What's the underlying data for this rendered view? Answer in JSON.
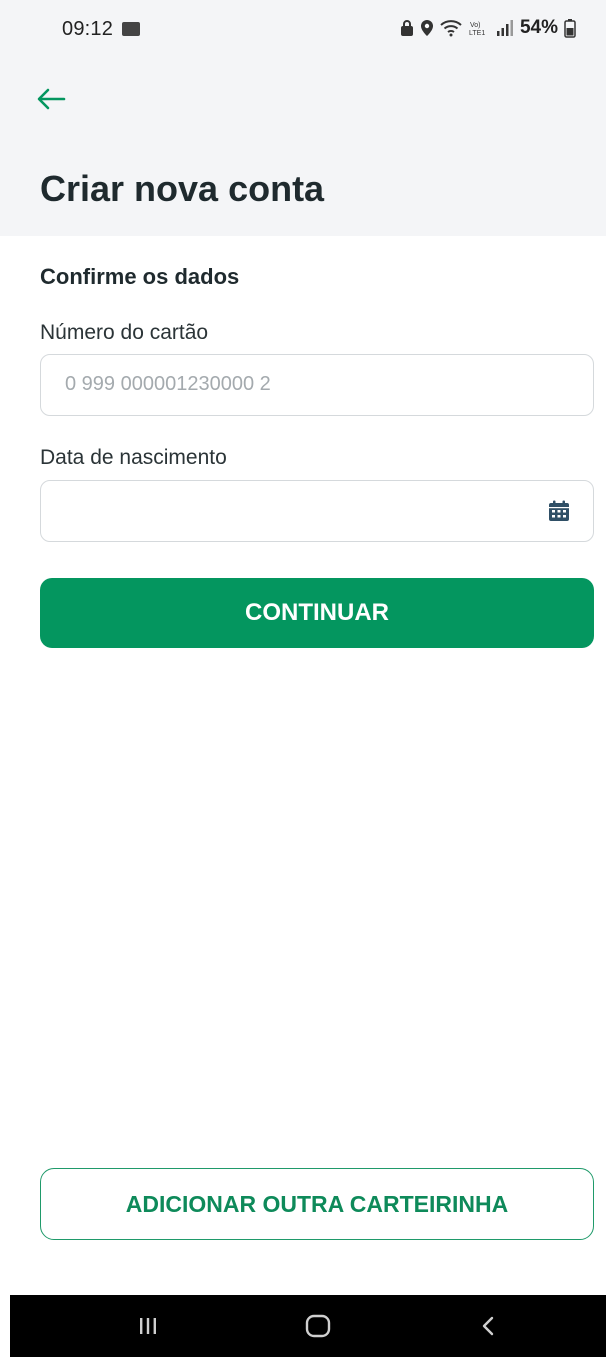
{
  "status_bar": {
    "time": "09:12",
    "battery": "54%",
    "icons": [
      "gallery-notification-icon",
      "lock-icon",
      "location-icon",
      "wifi-icon",
      "volte-icon",
      "signal-icon",
      "battery-icon"
    ]
  },
  "header": {
    "back_icon": "arrow-left-icon",
    "title": "Criar nova conta"
  },
  "form": {
    "section_title": "Confirme os dados",
    "card_number": {
      "label": "Número do cartão",
      "placeholder": "0 999 000001230000 2",
      "value": ""
    },
    "birth_date": {
      "label": "Data de nascimento",
      "placeholder": "",
      "value": "",
      "icon": "calendar-icon"
    },
    "continue_label": "CONTINUAR"
  },
  "footer": {
    "add_card_label": "ADICIONAR OUTRA CARTEIRINHA"
  },
  "nav": [
    "recent-apps-icon",
    "home-icon",
    "back-icon"
  ],
  "colors": {
    "primary": "#04965f",
    "primary_text": "#0e8a5a",
    "header_bg": "#f4f5f7",
    "text": "#1f2a2e"
  }
}
